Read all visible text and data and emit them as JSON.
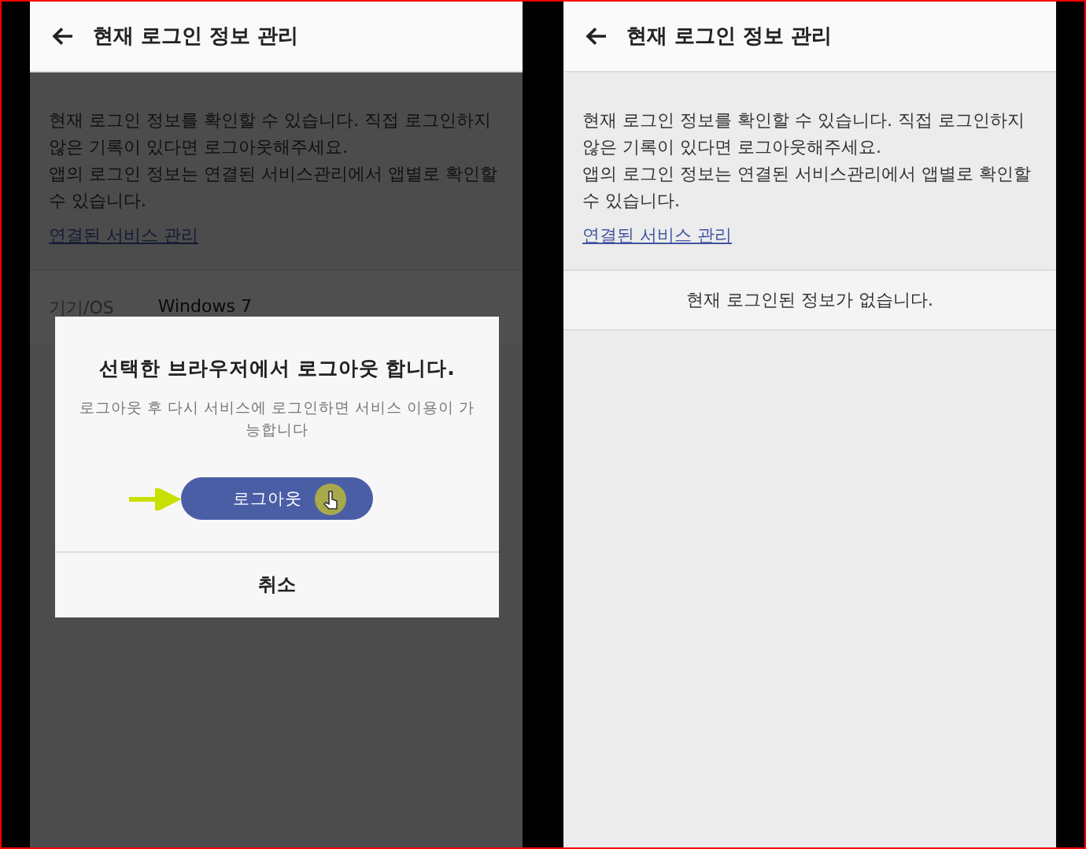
{
  "screens": [
    {
      "title": "현재 로그인 정보 관리",
      "description": [
        "현재 로그인 정보를 확인할 수 있습니다. 직접 로그인하지 않은 기록이 있다면 로그아웃해주세요.",
        "앱의 로그인 정보는 연결된 서비스관리에서 앱별로 확인할 수 있습니다."
      ],
      "link": "연결된 서비스 관리",
      "dimmed": true,
      "device_row": {
        "label": "기기/OS",
        "value": "Windows 7"
      },
      "dialog": {
        "title": "선택한 브라우저에서 로그아웃 합니다.",
        "message": "로그아웃 후 다시 서비스에 로그인하면 서비스 이용이 가능합니다",
        "confirm": "로그아웃",
        "cancel": "취소"
      }
    },
    {
      "title": "현재 로그인 정보 관리",
      "description": [
        "현재 로그인 정보를 확인할 수 있습니다. 직접 로그인하지 않은 기록이 있다면 로그아웃해주세요.",
        "앱의 로그인 정보는 연결된 서비스관리에서 앱별로 확인할 수 있습니다."
      ],
      "link": "연결된 서비스 관리",
      "dimmed": false,
      "empty_message": "현재 로그인된 정보가 없습니다."
    }
  ]
}
